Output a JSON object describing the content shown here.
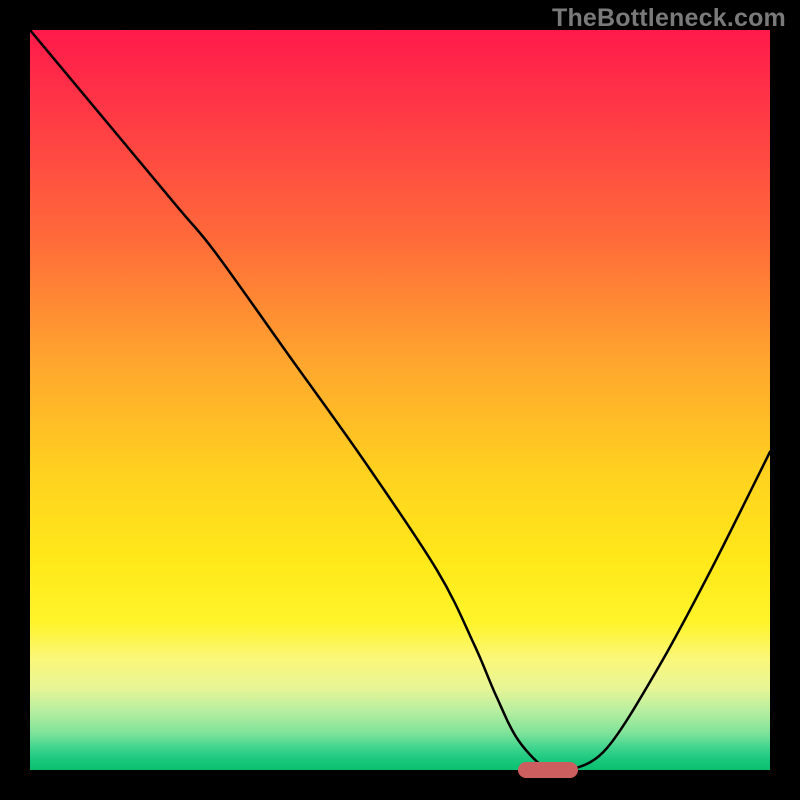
{
  "watermark": "TheBottleneck.com",
  "colors": {
    "background": "#000000",
    "curve": "#000000",
    "marker": "#cd5e60",
    "gradient_top": "#ff1a4b",
    "gradient_bottom": "#0abf6e"
  },
  "chart_data": {
    "type": "line",
    "title": "",
    "xlabel": "",
    "ylabel": "",
    "xlim": [
      0,
      100
    ],
    "ylim": [
      0,
      100
    ],
    "grid": false,
    "x": [
      0,
      10,
      20,
      25,
      35,
      45,
      55,
      60,
      63,
      66,
      70,
      73,
      78,
      85,
      92,
      100
    ],
    "values": [
      100,
      88,
      76,
      70,
      56,
      42,
      27,
      17,
      10,
      4,
      0,
      0,
      3,
      14,
      27,
      43
    ],
    "annotations": [
      {
        "kind": "marker",
        "x_start": 66,
        "x_end": 74,
        "y": 0
      }
    ],
    "interpretation": "V-shaped bottleneck curve; minimum (optimal) region highlighted by pill marker near x≈66–74%. Background gradient encodes bottleneck severity: red=high, green=low."
  }
}
